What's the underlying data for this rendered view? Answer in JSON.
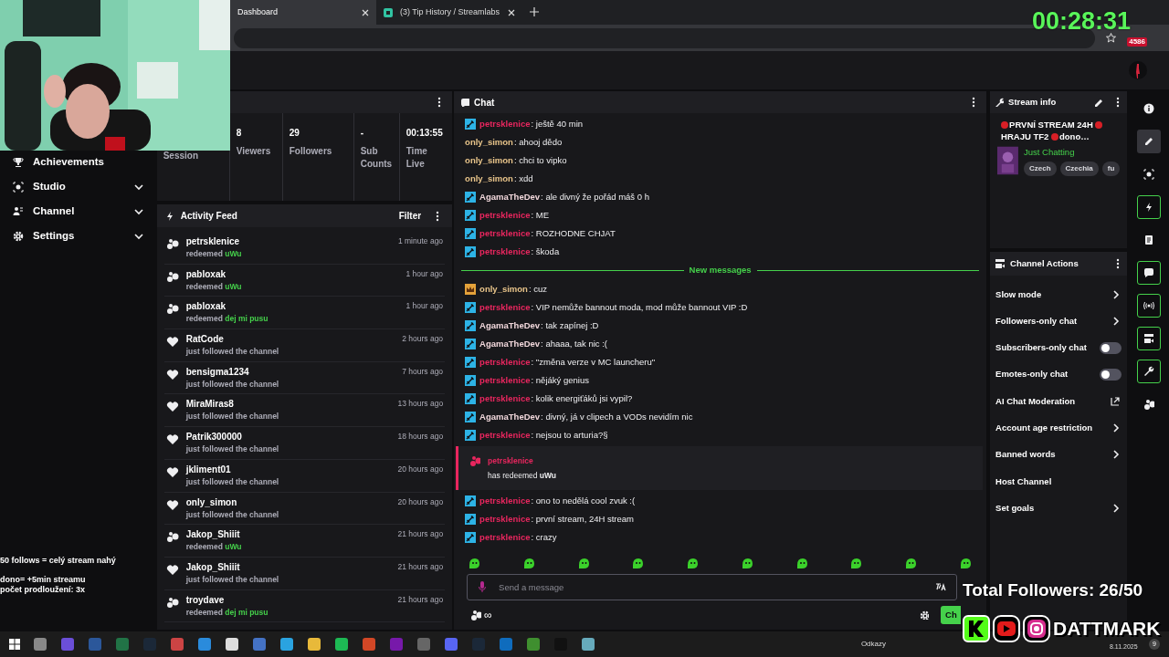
{
  "browser": {
    "tabs": [
      {
        "title": "Dashboard",
        "selected": true
      },
      {
        "title": "(3) Tip History / Streamlabs",
        "selected": false
      }
    ],
    "extension_badge": "4586"
  },
  "nav": [
    {
      "label": "Achievements",
      "kind": "link"
    },
    {
      "label": "Studio",
      "kind": "group"
    },
    {
      "label": "Channel",
      "kind": "group"
    },
    {
      "label": "Settings",
      "kind": "group"
    }
  ],
  "stats": [
    {
      "label": "Session"
    },
    {
      "value": "8",
      "label": "Viewers"
    },
    {
      "value": "29",
      "label": "Followers"
    },
    {
      "value": "-",
      "label": "Sub Counts"
    },
    {
      "value": "00:13:55",
      "label": "Time Live"
    }
  ],
  "activity_feed": {
    "title": "Activity Feed",
    "filter": "Filter",
    "items": [
      {
        "kind": "redeem",
        "user": "petrsklenice",
        "action": "redeemed",
        "reward": "uWu",
        "time": "1 minute ago"
      },
      {
        "kind": "redeem",
        "user": "pabloxak",
        "action": "redeemed",
        "reward": "uWu",
        "time": "1 hour ago"
      },
      {
        "kind": "redeem",
        "user": "pabloxak",
        "action": "redeemed",
        "reward": "dej mi pusu",
        "time": "1 hour ago"
      },
      {
        "kind": "follow",
        "user": "RatCode",
        "action": "just followed the channel",
        "time": "2 hours ago"
      },
      {
        "kind": "follow",
        "user": "bensigma1234",
        "action": "just followed the channel",
        "time": "7 hours ago"
      },
      {
        "kind": "follow",
        "user": "MiraMiras8",
        "action": "just followed the channel",
        "time": "13 hours ago"
      },
      {
        "kind": "follow",
        "user": "Patrik300000",
        "action": "just followed the channel",
        "time": "18 hours ago"
      },
      {
        "kind": "follow",
        "user": "jkliment01",
        "action": "just followed the channel",
        "time": "20 hours ago"
      },
      {
        "kind": "follow",
        "user": "only_simon",
        "action": "just followed the channel",
        "time": "20 hours ago"
      },
      {
        "kind": "redeem",
        "user": "Jakop_Shiiit",
        "action": "redeemed",
        "reward": "uWu",
        "time": "21 hours ago"
      },
      {
        "kind": "follow",
        "user": "Jakop_Shiiit",
        "action": "just followed the channel",
        "time": "21 hours ago"
      },
      {
        "kind": "redeem",
        "user": "troydave",
        "action": "redeemed",
        "reward": "dej mi pusu",
        "time": "21 hours ago"
      }
    ]
  },
  "chat": {
    "title": "Chat",
    "messages": [
      {
        "kind": "message",
        "mod": true,
        "vip": false,
        "user": "petrsklenice",
        "color": "#e8265e",
        "text": ": ještě 40 min"
      },
      {
        "kind": "message",
        "mod": false,
        "vip": false,
        "user": "only_simon",
        "color": "#e8c48a",
        "text": ": ahooj dědo"
      },
      {
        "kind": "message",
        "mod": false,
        "vip": false,
        "user": "only_simon",
        "color": "#e8c48a",
        "text": ": chci to vipko"
      },
      {
        "kind": "message",
        "mod": false,
        "vip": false,
        "user": "only_simon",
        "color": "#e8c48a",
        "text": ": xdd"
      },
      {
        "kind": "message",
        "mod": true,
        "vip": false,
        "user": "AgamaTheDev",
        "color": "#f2d8dc",
        "text": ": ale divný že pořád máš 0 h"
      },
      {
        "kind": "message",
        "mod": true,
        "vip": false,
        "user": "petrsklenice",
        "color": "#e8265e",
        "text": ": ME"
      },
      {
        "kind": "message",
        "mod": true,
        "vip": false,
        "user": "petrsklenice",
        "color": "#e8265e",
        "text": ": ROZHODNE CHJAT"
      },
      {
        "kind": "message",
        "mod": true,
        "vip": false,
        "user": "petrsklenice",
        "color": "#e8265e",
        "text": ": škoda"
      },
      {
        "kind": "divider",
        "text": "New messages"
      },
      {
        "kind": "message",
        "mod": false,
        "vip": true,
        "user": "only_simon",
        "color": "#e8c48a",
        "text": ": cuz"
      },
      {
        "kind": "message",
        "mod": true,
        "vip": false,
        "user": "petrsklenice",
        "color": "#e8265e",
        "text": ": VIP nemůže bannout moda, mod může bannout VIP :D"
      },
      {
        "kind": "message",
        "mod": true,
        "vip": false,
        "user": "AgamaTheDev",
        "color": "#f2d8dc",
        "text": ": tak zapínej :D"
      },
      {
        "kind": "message",
        "mod": true,
        "vip": false,
        "user": "AgamaTheDev",
        "color": "#f2d8dc",
        "text": ": ahaaa, tak nic :("
      },
      {
        "kind": "message",
        "mod": true,
        "vip": false,
        "user": "petrsklenice",
        "color": "#e8265e",
        "text": ": \"změna verze v MC launcheru\""
      },
      {
        "kind": "message",
        "mod": true,
        "vip": false,
        "user": "petrsklenice",
        "color": "#e8265e",
        "text": ": nějáký genius"
      },
      {
        "kind": "message",
        "mod": true,
        "vip": false,
        "user": "petrsklenice",
        "color": "#e8265e",
        "text": ": kolik energiťáků jsi vypil?"
      },
      {
        "kind": "message",
        "mod": true,
        "vip": false,
        "user": "AgamaTheDev",
        "color": "#f2d8dc",
        "text": ": divný, já v clipech a VODs nevidím nic"
      },
      {
        "kind": "message",
        "mod": true,
        "vip": false,
        "user": "petrsklenice",
        "color": "#e8265e",
        "text": ": nejsou to arturia?§"
      },
      {
        "kind": "redemption",
        "user": "petrsklenice",
        "color": "#e8265e",
        "text": "has redeemed **uWu**"
      },
      {
        "kind": "message",
        "mod": true,
        "vip": false,
        "user": "petrsklenice",
        "color": "#e8265e",
        "text": ": ono to nedělá cool zvuk :("
      },
      {
        "kind": "message",
        "mod": true,
        "vip": false,
        "user": "petrsklenice",
        "color": "#e8265e",
        "text": ": první stream, 24H stream"
      },
      {
        "kind": "message",
        "mod": true,
        "vip": false,
        "user": "petrsklenice",
        "color": "#e8265e",
        "text": ": crazy"
      }
    ],
    "input": {
      "placeholder": "Send a message"
    },
    "points": "∞",
    "send_button": "Ch"
  },
  "stream_info": {
    "title": "Stream info",
    "title_parts": [
      {
        "text": "PRVNÍ STREAM 24H",
        "dot": true
      },
      {
        "text": "HRAJU TF2",
        "dot": true
      },
      {
        "text": "dono…",
        "dot": true
      }
    ],
    "category": "Just Chatting",
    "tags": [
      "Czech",
      "Czechia",
      "fu"
    ]
  },
  "channel_actions": {
    "title": "Channel Actions",
    "items": [
      {
        "label": "Slow mode",
        "kind": "arrow"
      },
      {
        "label": "Followers-only chat",
        "kind": "arrow"
      },
      {
        "label": "Subscribers-only chat",
        "kind": "toggle",
        "on": false
      },
      {
        "label": "Emotes-only chat",
        "kind": "toggle",
        "on": false
      },
      {
        "label": "AI Chat Moderation",
        "kind": "external"
      },
      {
        "label": "Account age restriction",
        "kind": "arrow"
      },
      {
        "label": "Banned words",
        "kind": "arrow"
      },
      {
        "label": "Host Channel",
        "kind": "plain"
      },
      {
        "label": "Set goals",
        "kind": "arrow"
      }
    ]
  },
  "rail": [
    {
      "kind": "info",
      "selected": false,
      "pinned": false
    },
    {
      "kind": "pencil",
      "selected": true,
      "pinned": false
    },
    {
      "kind": "camera",
      "selected": false,
      "pinned": false
    },
    {
      "kind": "bolt",
      "selected": false,
      "pinned": true
    },
    {
      "kind": "doc",
      "selected": false,
      "pinned": false
    },
    {
      "kind": "chat",
      "selected": false,
      "pinned": true
    },
    {
      "kind": "broadcast",
      "selected": false,
      "pinned": true
    },
    {
      "kind": "video",
      "selected": false,
      "pinned": true
    },
    {
      "kind": "wrench",
      "selected": false,
      "pinned": true
    },
    {
      "kind": "dots",
      "selected": false,
      "pinned": false
    }
  ],
  "overlay": {
    "timer": "00:28:31",
    "notes": [
      "50 follows = celý stream nahý",
      "dono= +5min streamu",
      "počet prodloužení: 3x"
    ],
    "total_followers": "Total Followers: 26/50",
    "brand": "DATTMARK"
  },
  "taskbar": {
    "links": "Odkazy",
    "date": "8.11.2025",
    "notifications": "9"
  }
}
